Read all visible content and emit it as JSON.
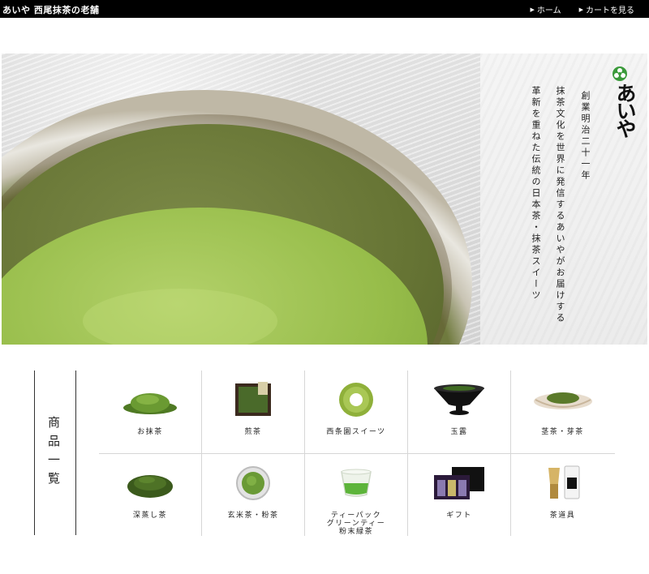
{
  "header": {
    "brand": "あいや 西尾抹茶の老舗",
    "nav": [
      {
        "label": "ホーム",
        "icon": "triangle-right-icon"
      },
      {
        "label": "カートを見る",
        "icon": "triangle-right-icon"
      }
    ]
  },
  "hero": {
    "logo": "あいや",
    "lines": [
      "創業明治二十一年",
      "抹茶文化を世界に発信するあいやがお届けする",
      "革新を重ねた伝統の日本茶・抹茶スイーツ"
    ],
    "accent": "#3a9a3a"
  },
  "products": {
    "title": "商品一覧",
    "row1": [
      {
        "label": "お抹茶",
        "icon": "matcha-powder-icon"
      },
      {
        "label": "煎茶",
        "icon": "sencha-box-icon"
      },
      {
        "label": "西条園スイーツ",
        "icon": "baumkuchen-icon"
      },
      {
        "label": "玉露",
        "icon": "gyokuro-bowl-icon"
      },
      {
        "label": "茎茶・芽茶",
        "icon": "kukicha-plate-icon"
      }
    ],
    "row2": [
      {
        "label": "深蒸し茶",
        "icon": "fukamushi-leaves-icon"
      },
      {
        "label": "玄米茶・粉茶",
        "icon": "genmaicha-bowl-icon"
      },
      {
        "label_l1": "ティーパック",
        "label_l2": "グリーンティー",
        "label_l3": "粉末緑茶",
        "icon": "green-tea-glass-icon"
      },
      {
        "label": "ギフト",
        "icon": "gift-box-icon"
      },
      {
        "label": "茶道具",
        "icon": "tea-utensils-icon"
      }
    ]
  }
}
